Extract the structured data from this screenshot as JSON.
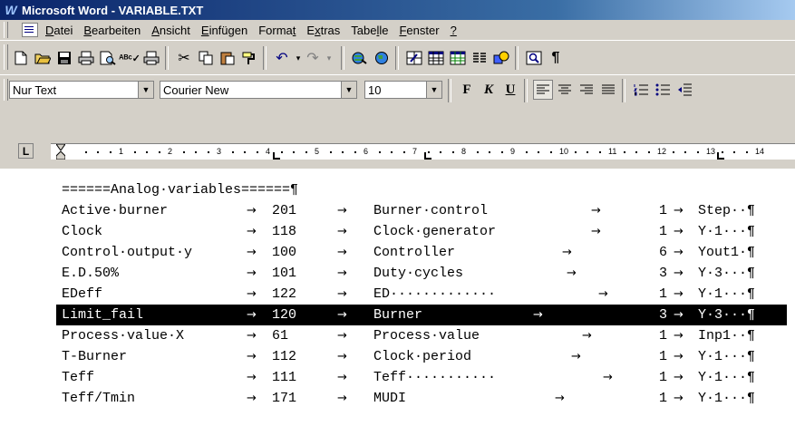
{
  "window": {
    "title": "Microsoft Word - VARIABLE.TXT"
  },
  "menu": [
    {
      "label": "Datei",
      "accel": "D"
    },
    {
      "label": "Bearbeiten",
      "accel": "B"
    },
    {
      "label": "Ansicht",
      "accel": "A"
    },
    {
      "label": "Einfügen",
      "accel": "E"
    },
    {
      "label": "Format",
      "accel": "t"
    },
    {
      "label": "Extras",
      "accel": "x"
    },
    {
      "label": "Tabelle",
      "accel": "l"
    },
    {
      "label": "Fenster",
      "accel": "F"
    },
    {
      "label": "?",
      "accel": "?"
    }
  ],
  "formatting": {
    "style": "Nur Text",
    "font": "Courier New",
    "size": "10",
    "bold": "F",
    "italic": "K",
    "underline": "U"
  },
  "ruler": {
    "numbers": [
      "1",
      "2",
      "3",
      "4",
      "5",
      "6",
      "7",
      "8",
      "9",
      "10",
      "11",
      "12",
      "13",
      "14"
    ]
  },
  "document": {
    "heading": "======Analog·variables======¶",
    "rows": [
      {
        "c1": "Active·burner",
        "c2": "201",
        "c3": "Burner·control",
        "c4": "1",
        "c5": "Step··¶",
        "selected": false
      },
      {
        "c1": "Clock",
        "c2": "118",
        "c3": "Clock·generator",
        "c4": "1",
        "c5": "Y·1···¶",
        "selected": false
      },
      {
        "c1": "Control·output·y",
        "c2": "100",
        "c3": "Controller",
        "c4": "6",
        "c5": "Yout1·¶",
        "selected": false
      },
      {
        "c1": "E.D.50%",
        "c2": "101",
        "c3": "Duty·cycles",
        "c4": "3",
        "c5": "Y·3···¶",
        "selected": false
      },
      {
        "c1": "EDeff",
        "c2": "122",
        "c3": "ED·············",
        "c4": "1",
        "c5": "Y·1···¶",
        "selected": false
      },
      {
        "c1": "Limit_fail",
        "c2": "120",
        "c3": "Burner",
        "c4": "3",
        "c5": "Y·3···¶",
        "selected": true
      },
      {
        "c1": "Process·value·X",
        "c2": "61",
        "c3": "Process·value",
        "c4": "1",
        "c5": "Inp1··¶",
        "selected": false
      },
      {
        "c1": "T-Burner",
        "c2": "112",
        "c3": "Clock·period",
        "c4": "1",
        "c5": "Y·1···¶",
        "selected": false
      },
      {
        "c1": "Teff",
        "c2": "111",
        "c3": "Teff···········",
        "c4": "1",
        "c5": "Y·1···¶",
        "selected": false
      },
      {
        "c1": "Teff/Tmin",
        "c2": "171",
        "c3": "MUDI",
        "c4": "1",
        "c5": "Y·1···¶",
        "selected": false
      }
    ]
  }
}
